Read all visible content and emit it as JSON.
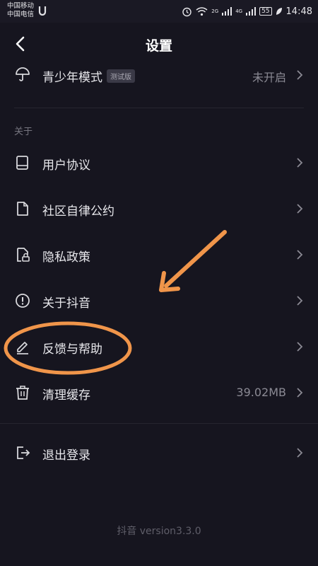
{
  "status_bar": {
    "carrier_1": "中国移动",
    "carrier_2": "中国电信",
    "signal_1": "2G",
    "signal_2": "4G",
    "battery": "55",
    "time": "14:48"
  },
  "header": {
    "title": "设置"
  },
  "teen_mode": {
    "label": "青少年模式",
    "badge": "测试版",
    "value": "未开启",
    "icon": "umbrella-icon"
  },
  "section_about": {
    "label": "关于"
  },
  "items": [
    {
      "label": "用户协议",
      "icon": "book-icon"
    },
    {
      "label": "社区自律公约",
      "icon": "document-icon"
    },
    {
      "label": "隐私政策",
      "icon": "lock-document-icon"
    },
    {
      "label": "关于抖音",
      "icon": "info-icon"
    },
    {
      "label": "反馈与帮助",
      "icon": "edit-icon"
    },
    {
      "label": "清理缓存",
      "value": "39.02MB",
      "icon": "trash-icon"
    }
  ],
  "logout": {
    "label": "退出登录",
    "icon": "logout-icon"
  },
  "footer": {
    "version": "抖音 version3.3.0"
  },
  "colors": {
    "background": "#16151f",
    "annotation": "#f0954a",
    "secondary_text": "#8b8a94"
  }
}
